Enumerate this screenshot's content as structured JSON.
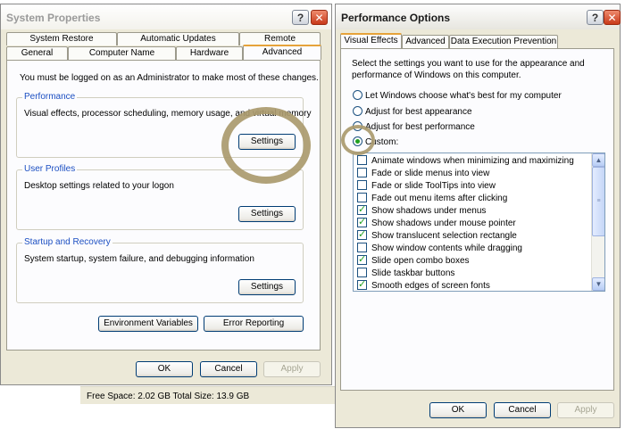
{
  "system_properties": {
    "title": "System Properties",
    "help_icon": "?",
    "close_icon": "✕",
    "tabs_back": [
      "System Restore",
      "Automatic Updates",
      "Remote"
    ],
    "tabs_front": [
      "General",
      "Computer Name",
      "Hardware",
      "Advanced"
    ],
    "active_tab": "Advanced",
    "admin_notice": "You must be logged on as an Administrator to make most of these changes.",
    "performance": {
      "title": "Performance",
      "description": "Visual effects, processor scheduling, memory usage, and virtual memory",
      "button": "Settings"
    },
    "user_profiles": {
      "title": "User Profiles",
      "description": "Desktop settings related to your logon",
      "button": "Settings"
    },
    "startup_recovery": {
      "title": "Startup and Recovery",
      "description": "System startup, system failure, and debugging information",
      "button": "Settings"
    },
    "env_vars_button": "Environment Variables",
    "error_reporting_button": "Error Reporting",
    "ok_button": "OK",
    "cancel_button": "Cancel",
    "apply_button": "Apply"
  },
  "status_bar": {
    "text": "Free Space: 2.02 GB Total Size: 13.9 GB"
  },
  "performance_options": {
    "title": "Performance Options",
    "help_icon": "?",
    "close_icon": "✕",
    "tabs": [
      "Visual Effects",
      "Advanced",
      "Data Execution Prevention"
    ],
    "active_tab": "Visual Effects",
    "intro_line1": "Select the settings you want to use for the appearance and",
    "intro_line2": "performance of Windows on this computer.",
    "radios": [
      {
        "label": "Let Windows choose what's best for my computer",
        "selected": false
      },
      {
        "label": "Adjust for best appearance",
        "selected": false
      },
      {
        "label": "Adjust for best performance",
        "selected": false
      },
      {
        "label": "Custom:",
        "selected": true
      }
    ],
    "effects": [
      {
        "label": "Animate windows when minimizing and maximizing",
        "checked": false
      },
      {
        "label": "Fade or slide menus into view",
        "checked": false
      },
      {
        "label": "Fade or slide ToolTips into view",
        "checked": false
      },
      {
        "label": "Fade out menu items after clicking",
        "checked": false
      },
      {
        "label": "Show shadows under menus",
        "checked": true
      },
      {
        "label": "Show shadows under mouse pointer",
        "checked": true
      },
      {
        "label": "Show translucent selection rectangle",
        "checked": true
      },
      {
        "label": "Show window contents while dragging",
        "checked": false
      },
      {
        "label": "Slide open combo boxes",
        "checked": true
      },
      {
        "label": "Slide taskbar buttons",
        "checked": false
      },
      {
        "label": "Smooth edges of screen fonts",
        "checked": true
      }
    ],
    "ok_button": "OK",
    "cancel_button": "Cancel",
    "apply_button": "Apply"
  },
  "colors": {
    "window_bg": "#ece9d8",
    "group_title": "#1c4fc2",
    "button_border": "#003c74",
    "check_green": "#21a121",
    "annotation_ring": "#aa9a6e"
  }
}
